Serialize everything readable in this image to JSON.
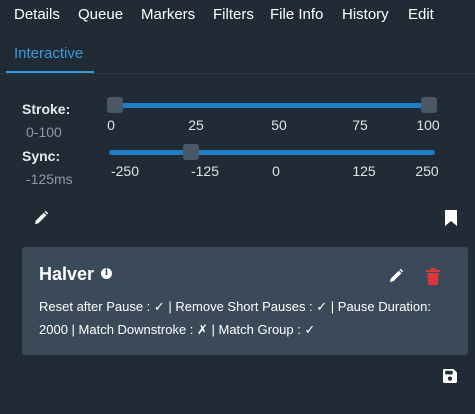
{
  "tabs": [
    {
      "label": "Details"
    },
    {
      "label": "Queue"
    },
    {
      "label": "Markers"
    },
    {
      "label": "Filters"
    },
    {
      "label": "File Info"
    },
    {
      "label": "History"
    },
    {
      "label": "Edit"
    }
  ],
  "active_tab": {
    "label": "Interactive"
  },
  "stroke": {
    "label": "Stroke:",
    "value_text": "0-100",
    "range": [
      0,
      100
    ],
    "value_low": 0,
    "value_high": 100,
    "ticks": [
      "0",
      "25",
      "50",
      "75",
      "100"
    ]
  },
  "sync": {
    "label": "Sync:",
    "value_text": "-125ms",
    "range": [
      -250,
      250
    ],
    "value": -125,
    "ticks": [
      "-250",
      "-125",
      "0",
      "125",
      "250"
    ]
  },
  "icons": {
    "edit": "pencil-icon",
    "bookmark": "bookmark-icon",
    "info": "info-icon",
    "delete": "trash-icon",
    "save": "save-icon"
  },
  "colors": {
    "accent": "#3a9ad9",
    "slider": "#1f7ec6",
    "delete": "#d9363e",
    "card": "#3b4a58",
    "background": "#212b35"
  },
  "filter_card": {
    "title": "Halver",
    "description": "Reset after Pause : ✓ | Remove Short Pauses : ✓ | Pause Duration: 2000 | Match Downstroke : ✗ | Match Group : ✓"
  }
}
